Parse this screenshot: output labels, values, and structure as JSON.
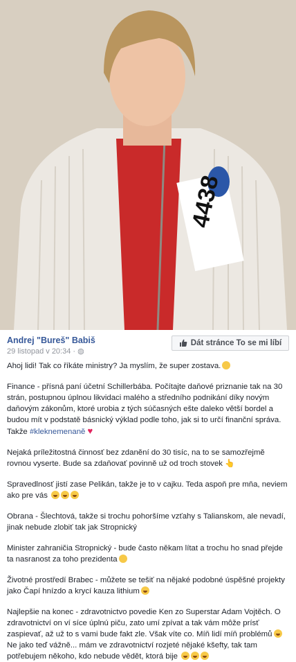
{
  "post": {
    "author": "Andrej \"Bureš\" Babiš",
    "timestamp": "29 listopad v 20:34",
    "privacy_icon": "globe-icon",
    "like_button_label": "Dát stránce To se mi líbí",
    "photo_bib_number": "4438"
  },
  "paragraphs": [
    "Ahoj lidi! Tak co říkáte ministry? Ja myslím, že super zostava.",
    "Finance - přísná paní účetní Schillerbába. Počítajte daňové priznanie tak na 30 strán, postupnou úplnou likvidaci malého a středního podnikání díky novým daňovým zákonům, ktoré urobia z tých súčasných ešte daleko větší bordel a budou mít v podstatě básnický výklad podle toho, jak si to určí finanční správa. Takže",
    "#kleknemenaně",
    "Nejaká príležitostná činnosť bez zdanění do 30 tisíc, na to se samozřejmě rovnou vyserte. Bude sa zdaňovať povinně už od troch stovek",
    "Spravedlnosť jistí zase Pelikán, takže je to v cajku. Teda aspoň pre mňa, neviem ako pre vás",
    "Obrana - Šlechtová, takže si trochu pohoršíme vzťahy s Talianskom, ale nevadí, jinak nebude zlobiť tak jak Stropnický",
    "Minister zahraničia Stropnický - bude často někam lítat a trochu ho snad přejde ta nasranost za toho prezidenta",
    "Životné prostředí Brabec - můžete se tešiť na nějaké podobné úspěšné projekty jako Čapí hnízdo a krycí kauza lithium",
    "Najlepšie na konec - zdravotnictvo povedie Ken zo Superstar Adam Vojtěch. O zdravotnictví on ví síce úplnú piču, zato umí zpívat a tak vám môže prísť zaspievať, až už to s vami bude fakt zle. Však víte co. Míň lidí míň problémů",
    "Ne jako teď vážně... mám ve zdravotnictví rozjeté nějaké kšefty, tak tam potřebujem někoho, kdo nebude vědět, ktorá bije"
  ],
  "colors": {
    "link_blue": "#365899",
    "sweater": "#ece8e2",
    "shirt_red": "#c92a2a"
  }
}
